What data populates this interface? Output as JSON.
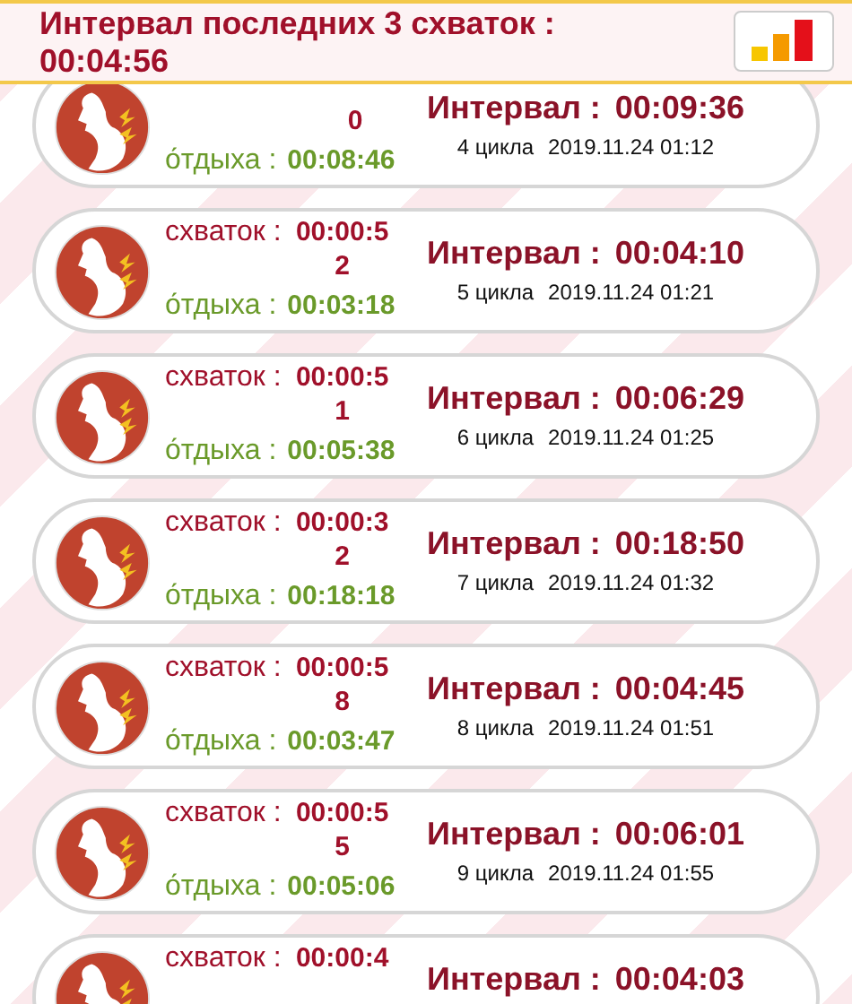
{
  "header": {
    "title": "Интервал последних 3 схваток : 00:04:56"
  },
  "records": [
    {
      "clipped_top": true,
      "contraction_value": "0",
      "rest_label": "о́тдыха :",
      "rest_value": "00:08:46",
      "interval_label": "Интервал :",
      "interval_value": "00:09:36",
      "cycle": "4 цикла",
      "datetime": "2019.11.24 01:12"
    },
    {
      "clipped_top": false,
      "contraction_label": "схваток :",
      "contraction_value": "00:00:52",
      "rest_label": "о́тдыха :",
      "rest_value": "00:03:18",
      "interval_label": "Интервал :",
      "interval_value": "00:04:10",
      "cycle": "5 цикла",
      "datetime": "2019.11.24 01:21"
    },
    {
      "clipped_top": false,
      "contraction_label": "схваток :",
      "contraction_value": "00:00:51",
      "rest_label": "о́тдыха :",
      "rest_value": "00:05:38",
      "interval_label": "Интервал :",
      "interval_value": "00:06:29",
      "cycle": "6 цикла",
      "datetime": "2019.11.24 01:25"
    },
    {
      "clipped_top": false,
      "contraction_label": "схваток :",
      "contraction_value": "00:00:32",
      "rest_label": "о́тдыха :",
      "rest_value": "00:18:18",
      "interval_label": "Интервал :",
      "interval_value": "00:18:50",
      "cycle": "7 цикла",
      "datetime": "2019.11.24 01:32"
    },
    {
      "clipped_top": false,
      "contraction_label": "схваток :",
      "contraction_value": "00:00:58",
      "rest_label": "о́тдыха :",
      "rest_value": "00:03:47",
      "interval_label": "Интервал :",
      "interval_value": "00:04:45",
      "cycle": "8 цикла",
      "datetime": "2019.11.24 01:51"
    },
    {
      "clipped_top": false,
      "contraction_label": "схваток :",
      "contraction_value": "00:00:55",
      "rest_label": "о́тдыха :",
      "rest_value": "00:05:06",
      "interval_label": "Интервал :",
      "interval_value": "00:06:01",
      "cycle": "9 цикла",
      "datetime": "2019.11.24 01:55"
    },
    {
      "clipped_top": false,
      "contraction_label": "схваток :",
      "contraction_value": "00:00:4",
      "interval_label": "Интервал :",
      "interval_value": "00:04:03"
    }
  ]
}
